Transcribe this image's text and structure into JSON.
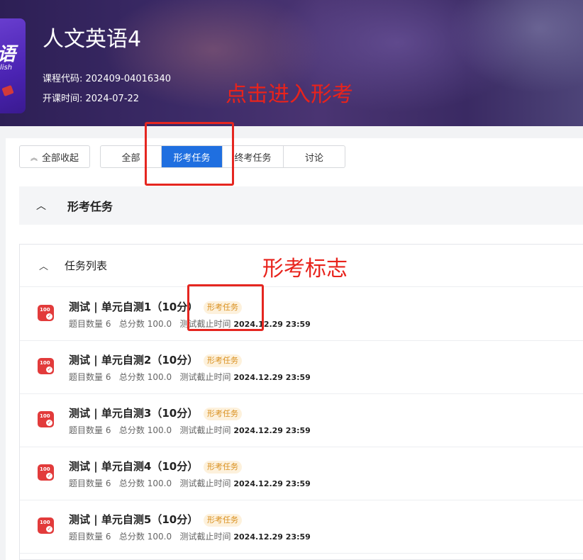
{
  "header": {
    "course_title": "人文英语4",
    "course_code": "课程代码: 202409-04016340",
    "start_date": "开课时间: 2024-07-22",
    "cover_text_big": "语",
    "cover_text_small": "lish"
  },
  "annotations": {
    "enter_note": "点击进入形考",
    "badge_note": "形考标志"
  },
  "toolbar": {
    "collapse_all": "全部收起"
  },
  "tabs": [
    {
      "label": "全部",
      "active": false
    },
    {
      "label": "形考任务",
      "active": true
    },
    {
      "label": "终考任务",
      "active": false
    },
    {
      "label": "讨论",
      "active": false
    }
  ],
  "section": {
    "title": "形考任务"
  },
  "task_list": {
    "title": "任务列表",
    "badge_label": "形考任务",
    "items": [
      {
        "name": "测试 | 单元自测1（10分）",
        "question_count": "题目数量 6",
        "total_score": "总分数 100.0",
        "deadline_label": "测试截止时间",
        "deadline": "2024.12.29 23:59"
      },
      {
        "name": "测试 | 单元自测2（10分）",
        "question_count": "题目数量 6",
        "total_score": "总分数 100.0",
        "deadline_label": "测试截止时间",
        "deadline": "2024.12.29 23:59"
      },
      {
        "name": "测试 | 单元自测3（10分）",
        "question_count": "题目数量 6",
        "total_score": "总分数 100.0",
        "deadline_label": "测试截止时间",
        "deadline": "2024.12.29 23:59"
      },
      {
        "name": "测试 | 单元自测4（10分）",
        "question_count": "题目数量 6",
        "total_score": "总分数 100.0",
        "deadline_label": "测试截止时间",
        "deadline": "2024.12.29 23:59"
      },
      {
        "name": "测试 | 单元自测5（10分）",
        "question_count": "题目数量 6",
        "total_score": "总分数 100.0",
        "deadline_label": "测试截止时间",
        "deadline": "2024.12.29 23:59"
      }
    ]
  },
  "icons": {
    "task_icon_text": "100"
  },
  "colors": {
    "accent": "#1f6fe0",
    "annotation_red": "#e8231c",
    "badge_bg": "#fdf1dc",
    "badge_text": "#d9901f",
    "task_icon": "#e23b3b"
  }
}
